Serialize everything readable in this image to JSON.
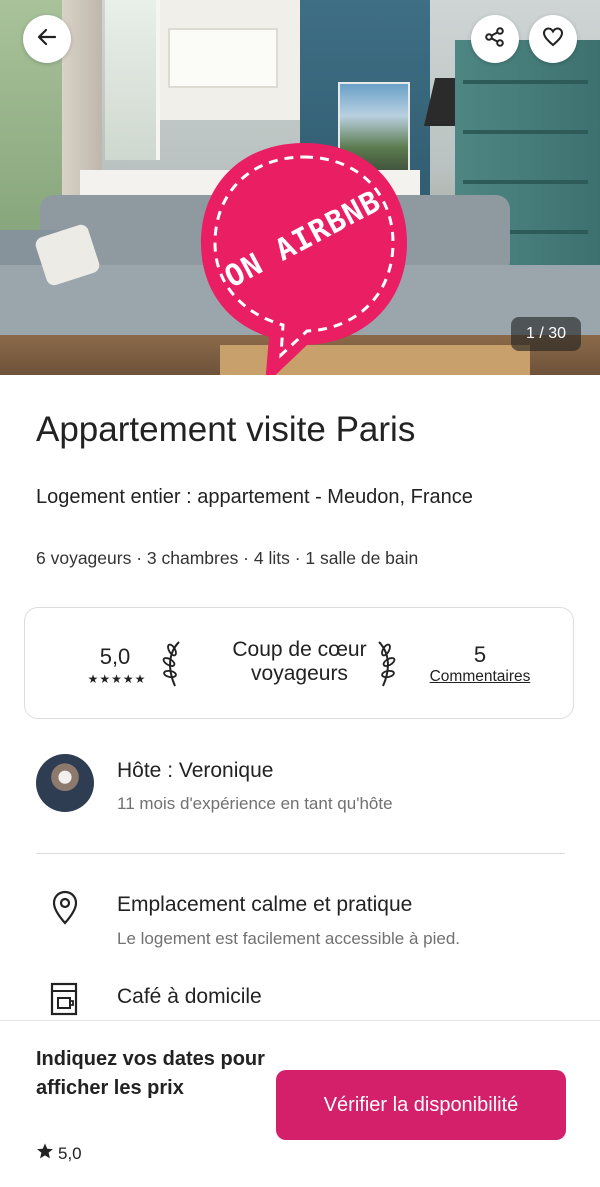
{
  "hero": {
    "photo_counter": "1 / 30",
    "sticker_text": "ON AIRBNB",
    "back_icon": "arrow-left-icon",
    "share_icon": "share-icon",
    "favorite_icon": "heart-icon"
  },
  "listing": {
    "title": "Appartement visite Paris",
    "subtitle": "Logement entier : appartement - Meudon, France",
    "details": "6 voyageurs · 3 chambres · 4 lits · 1 salle de bain"
  },
  "rating_card": {
    "score": "5,0",
    "stars": "★★★★★",
    "guest_favorite_line1": "Coup de cœur",
    "guest_favorite_line2": "voyageurs",
    "review_count": "5",
    "reviews_link": "Commentaires"
  },
  "host": {
    "name": "Hôte : Veronique",
    "experience": "11 mois d'expérience en tant qu'hôte"
  },
  "features": [
    {
      "icon": "location-pin-icon",
      "title": "Emplacement calme et pratique",
      "description": "Le logement est facilement accessible à pied."
    },
    {
      "icon": "coffee-machine-icon",
      "title": "Café à domicile",
      "description": ""
    }
  ],
  "bottom_bar": {
    "price_prompt": "Indiquez vos dates pour afficher les prix",
    "rating": "5,0",
    "cta_label": "Vérifier la disponibilité"
  },
  "colors": {
    "brand": "#d41f6a",
    "sticker": "#e91e63",
    "text": "#222222",
    "muted": "#717171"
  }
}
